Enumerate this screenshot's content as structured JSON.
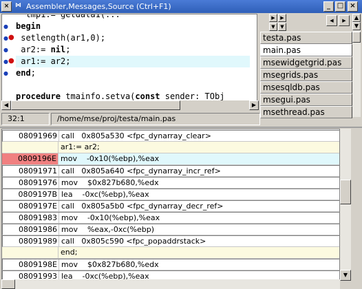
{
  "window": {
    "title": "Assembler,Messages,Source (Ctrl+F1)",
    "buttons": [
      "_",
      "□",
      "×"
    ]
  },
  "source": {
    "lines": [
      {
        "parts": [
          {
            "t": "  tmp1:= getdata1(...",
            "b": false
          }
        ],
        "gutter": "",
        "hl": false
      },
      {
        "parts": [
          {
            "t": "begin",
            "b": true
          }
        ],
        "gutter": "dot",
        "hl": false
      },
      {
        "parts": [
          {
            "t": " setlength(ar1,0);",
            "b": false
          }
        ],
        "gutter": "dot-bp",
        "hl": false
      },
      {
        "parts": [
          {
            "t": " ar2:= ",
            "b": false
          },
          {
            "t": "nil",
            "b": true
          },
          {
            "t": ";",
            "b": false
          }
        ],
        "gutter": "dot",
        "hl": false
      },
      {
        "parts": [
          {
            "t": " ar1:= ar2;",
            "b": false
          }
        ],
        "gutter": "dot-bp",
        "hl": true
      },
      {
        "parts": [
          {
            "t": "end",
            "b": true
          },
          {
            "t": ";",
            "b": false
          }
        ],
        "gutter": "dot",
        "hl": false
      },
      {
        "parts": [
          {
            "t": "",
            "b": false
          }
        ],
        "gutter": "",
        "hl": false
      },
      {
        "parts": [
          {
            "t": "procedure",
            "b": true
          },
          {
            "t": " tmainfo.setva(",
            "b": false
          },
          {
            "t": "const",
            "b": true
          },
          {
            "t": " sender: TObj",
            "b": false
          }
        ],
        "gutter": "",
        "hl": false
      }
    ]
  },
  "status": {
    "position": "32:1",
    "path": "/home/mse/proj/testa/main.pas"
  },
  "files": [
    {
      "name": "testa.pas",
      "active": false
    },
    {
      "name": "main.pas",
      "active": true
    },
    {
      "name": "msewidgetgrid.pas",
      "active": false
    },
    {
      "name": "msegrids.pas",
      "active": false
    },
    {
      "name": "msesqldb.pas",
      "active": false
    },
    {
      "name": "msegui.pas",
      "active": false
    },
    {
      "name": "msethread.pas",
      "active": false
    }
  ],
  "assembler": [
    {
      "addr": "08091969",
      "instr": "call   0x805a530 <fpc_dynarray_clear>",
      "kind": "asm"
    },
    {
      "addr": "",
      "instr": "ar1:= ar2;",
      "kind": "src"
    },
    {
      "addr": "0809196E",
      "instr": "mov    -0x10(%ebp),%eax",
      "kind": "cur"
    },
    {
      "addr": "08091971",
      "instr": "call   0x805a640 <fpc_dynarray_incr_ref>",
      "kind": "asm"
    },
    {
      "addr": "08091976",
      "instr": "mov    $0x827b680,%edx",
      "kind": "asm"
    },
    {
      "addr": "0809197B",
      "instr": "lea    -0xc(%ebp),%eax",
      "kind": "asm"
    },
    {
      "addr": "0809197E",
      "instr": "call   0x805a5b0 <fpc_dynarray_decr_ref>",
      "kind": "asm"
    },
    {
      "addr": "08091983",
      "instr": "mov    -0x10(%ebp),%eax",
      "kind": "asm"
    },
    {
      "addr": "08091986",
      "instr": "mov    %eax,-0xc(%ebp)",
      "kind": "asm"
    },
    {
      "addr": "08091989",
      "instr": "call   0x805c590 <fpc_popaddrstack>",
      "kind": "asm"
    },
    {
      "addr": "",
      "instr": "end;",
      "kind": "src"
    },
    {
      "addr": "0809198E",
      "instr": "mov    $0x827b680,%edx",
      "kind": "asm"
    },
    {
      "addr": "08091993",
      "instr": "lea    -0xc(%ebp),%eax",
      "kind": "asm"
    }
  ],
  "colors": {
    "current_line": "#e0f8fc",
    "current_addr": "#f08080",
    "source_row": "#fcfae0",
    "breakpoint": "#d01010",
    "line_marker": "#1a3fb8"
  }
}
